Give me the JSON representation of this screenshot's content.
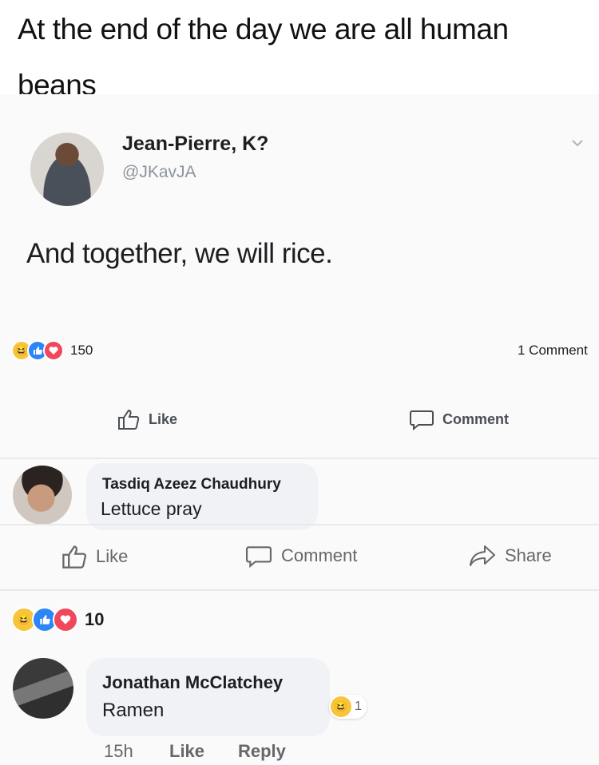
{
  "meme": {
    "caption": "At the end of the day we are all human beans"
  },
  "post": {
    "author": "Jean-Pierre, K?",
    "handle": "@JKavJA",
    "text": "And together, we will rice.",
    "reaction_count": "150",
    "comment_count": "1 Comment",
    "actions": {
      "like_label": "Like",
      "comment_label": "Comment"
    }
  },
  "comments": [
    {
      "author": "Tasdiq Azeez Chaudhury",
      "text": "Lettuce pray",
      "actions": {
        "like_label": "Like",
        "comment_label": "Comment",
        "share_label": "Share"
      },
      "reaction_count": "10"
    },
    {
      "author": "Jonathan McClatchey",
      "text": "Ramen",
      "reaction_count": "1",
      "time": "15h",
      "like_label": "Like",
      "reply_label": "Reply"
    }
  ],
  "colors": {
    "like_blue": "#2d86f5",
    "love_red": "#f0475a",
    "haha_yellow": "#f7c53b",
    "bubble_grey": "#f0f2f5",
    "meta_grey": "#65676b"
  }
}
